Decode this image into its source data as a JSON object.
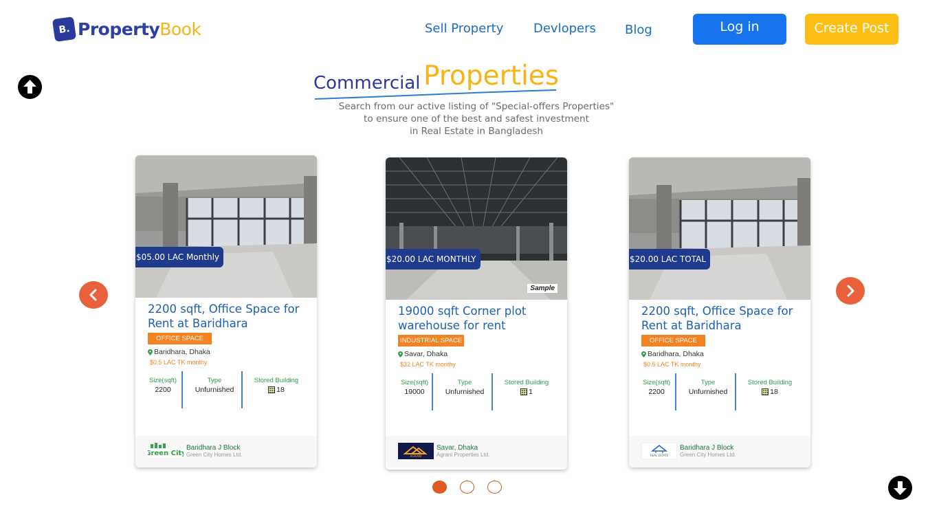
{
  "header": {
    "logo": {
      "mark": "B.",
      "text_part1": "Property",
      "text_part2": "Book"
    },
    "nav": [
      {
        "label": "Sell Property"
      },
      {
        "label": "Devlopers"
      },
      {
        "label": "Blog"
      }
    ],
    "login_label": "Log in",
    "create_post_label": "Create Post"
  },
  "section": {
    "title_small": "Commercial",
    "title_big": "Properties",
    "subtitle_lines": [
      "Search from our active listing of \"Special-offers Properties\"",
      "to ensure one of the best and safest investment",
      "in Real Estate in Bangladesh"
    ]
  },
  "stat_labels": {
    "size": "Size(sqft)",
    "type": "Type",
    "stored": "Stored Building"
  },
  "cards": [
    {
      "price_tag": "$05.00 LAC Monthly",
      "title": "2200 sqft, Office Space for Rent at Baridhara",
      "category": "OFFICE SPACE",
      "location": "Baridhara, Dhaka",
      "price": "$0.5 LAC TK monthy",
      "size": "2200",
      "type": "Unfurnished",
      "stored": "18",
      "dev_name": "Baridhara J Block",
      "dev_company": "Green City Homes Ltd.",
      "dev_logo_text": "Green City"
    },
    {
      "price_tag": "$20.00 LAC MONTHLY",
      "title": "19000 sqft Corner plot warehouse for rent",
      "category": "INDUSTRIAL SPACE",
      "location": "Savar, Dhaka",
      "price": "$32 LAC TK monthy",
      "size": "19000",
      "type": "Unfurnished",
      "stored": "1",
      "badge": "Sample",
      "dev_name": "Savar, Dhaka",
      "dev_company": "Agrani Properties Ltd.",
      "dev_logo_text": "AGRANI"
    },
    {
      "price_tag": "$20.00 LAC TOTAL",
      "title": "2200 sqft, Office Space for Rent at Baridhara",
      "category": "OFFICE SPACE",
      "location": "Baridhara, Dhaka",
      "price": "$0.5 LAC TK monthy",
      "size": "2200",
      "type": "Unfurnished",
      "stored": "18",
      "dev_name": "Baridhara J Block",
      "dev_company": "Green City Homes Ltd.",
      "dev_logo_text": "REAL ESTATE"
    }
  ],
  "carousel": {
    "pages": 3,
    "active_page": 1
  },
  "colors": {
    "brand_blue": "#2d3fa3",
    "brand_yellow": "#f7b416",
    "accent_orange": "#e8613a",
    "link_blue": "#1b6cc2"
  },
  "icons": [
    "arrow-up-icon",
    "arrow-down-icon",
    "chevron-left-icon",
    "chevron-right-icon",
    "location-pin-icon",
    "building-icon"
  ]
}
